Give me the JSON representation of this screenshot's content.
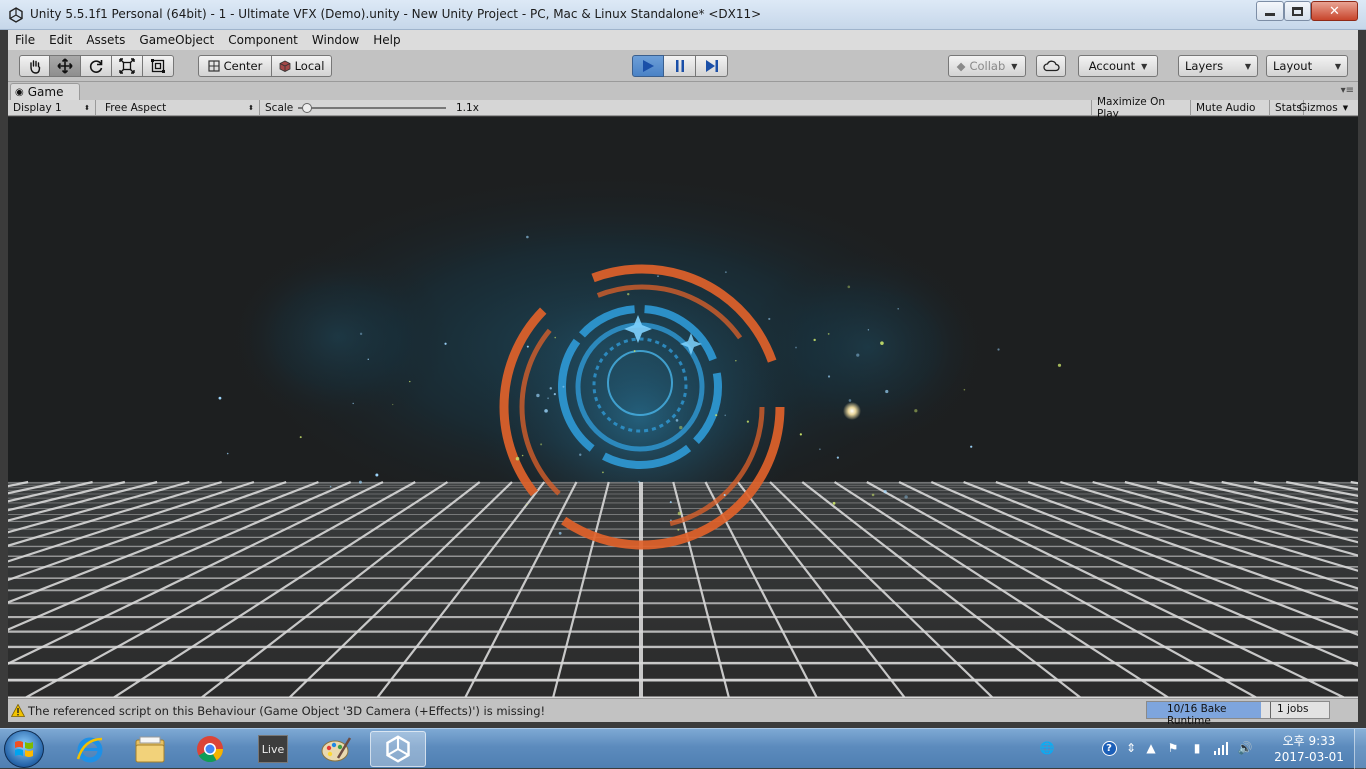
{
  "window": {
    "title": "Unity 5.5.1f1 Personal (64bit) - 1 - Ultimate VFX (Demo).unity - New Unity Project - PC, Mac & Linux Standalone* <DX11>"
  },
  "menu": [
    "File",
    "Edit",
    "Assets",
    "GameObject",
    "Component",
    "Window",
    "Help"
  ],
  "toolbar": {
    "tools": [
      "hand-tool",
      "move-tool",
      "rotate-tool",
      "scale-tool",
      "rect-tool"
    ],
    "pivot_center_label": "Center",
    "pivot_local_label": "Local",
    "collab_label": "Collab",
    "account_label": "Account",
    "layers_label": "Layers",
    "layout_label": "Layout"
  },
  "game_view": {
    "tab_label": "Game",
    "display_label": "Display 1",
    "aspect_label": "Free Aspect",
    "scale_label": "Scale",
    "scale_value": "1.1x",
    "maximize_label": "Maximize On Play",
    "mute_label": "Mute Audio",
    "stats_label": "Stats",
    "gizmos_label": "Gizmos"
  },
  "status": {
    "message": "The referenced script on this Behaviour (Game Object '3D Camera (+Effects)') is missing!",
    "bake_label": "10/16 Bake Runtime",
    "bake_progress": 0.625,
    "jobs_label": "1 jobs"
  },
  "taskbar": {
    "apps": [
      "internet-explorer-icon",
      "file-explorer-icon",
      "chrome-icon",
      "live-icon",
      "paint-icon",
      "unity-icon"
    ],
    "live_label": "Live",
    "time": "오후 9:33",
    "date": "2017-03-01"
  },
  "colors": {
    "accent_orange": "#e0622a",
    "accent_blue": "#2f9ad6",
    "play_blue": "#4a82c6"
  }
}
